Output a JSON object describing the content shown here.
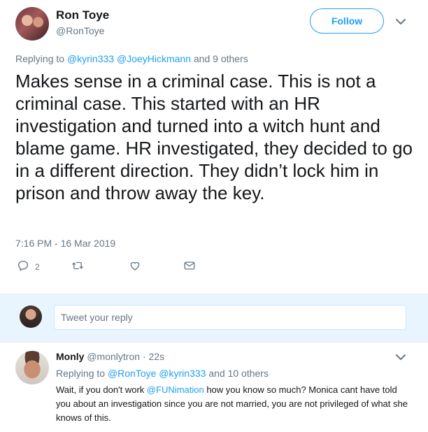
{
  "tweet": {
    "author_name": "Ron Toye",
    "author_handle": "@RonToye",
    "follow_label": "Follow",
    "replying_prefix": "Replying to",
    "replying_mention_1": "@kyrin333",
    "replying_mention_2": "@JoeyHickmann",
    "replying_suffix": "and 9 others",
    "text": "Makes sense in a criminal case. This is not a criminal case. This started with an HR investigation and turned into a witch hunt and blame game. HR investigated, they decided to go in a different direction. They didn’t lock him in prison and throw away the key.",
    "timestamp": "7:16 PM - 16 Mar 2019",
    "actions": {
      "reply_count": "2"
    }
  },
  "reply_box": {
    "placeholder": "Tweet your reply"
  },
  "reply": {
    "name": "Monly",
    "handle_time": "@monlytron · 22s",
    "replying_prefix": "Replying to",
    "replying_mention_1": "@RonToye",
    "replying_mention_2": "@kyrin333",
    "replying_suffix": "and 10 others",
    "text_part1": "Wait, if you don't work ",
    "text_mention": "@FUNimation",
    "text_part2": " how you know so much? Monica cant have told you about an investigation since you are not married, you are not privileged of what she knows of this."
  },
  "colors": {
    "accent": "#1da1f2",
    "muted": "#657786",
    "text": "#14171a",
    "reply_bar_bg": "#e8f5fe"
  },
  "icons": [
    "chevron-down-icon",
    "reply-icon",
    "retweet-icon",
    "like-icon",
    "message-icon"
  ]
}
